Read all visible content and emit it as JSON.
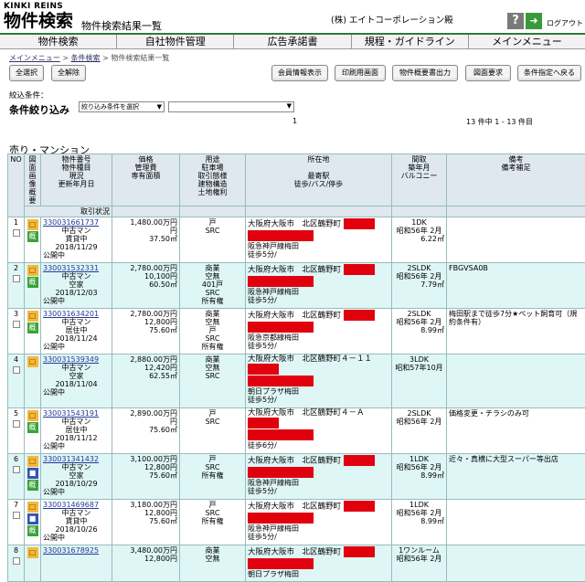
{
  "header": {
    "brand_en": "KINKI REINS",
    "title": "物件検索",
    "subtitle": "物件検索結果一覧",
    "company": "(株) エイトコーポレーション殿",
    "help_icon": "?",
    "logout": "ログアウト",
    "accent": "#2c7a3a"
  },
  "nav": [
    "物件検索",
    "自社物件管理",
    "広告承諾書",
    "規程・ガイドライン",
    "メインメニュー"
  ],
  "breadcrumb": {
    "items": [
      "メインメニュー",
      "条件検索",
      "物件検索結果一覧"
    ],
    "sep": ">"
  },
  "buttons": {
    "select_all": "全選択",
    "clear_all": "全解除",
    "member_info": "会員情報表示",
    "print": "印刷用画面",
    "summary": "物件概要書出力",
    "map": "図面要求",
    "back": "条件指定へ戻る"
  },
  "filter": {
    "label": "絞込条件：",
    "refine_label": "条件絞り込み",
    "select_value": "絞り込み条件を選択",
    "pager_page": "1",
    "count": "13 件中 1 - 13 件目"
  },
  "section_title": "売り・マンション",
  "columns": {
    "no": "NO",
    "media": [
      "図面",
      "画像",
      "概要"
    ],
    "id": [
      "物件番号",
      "物件種目",
      "現況",
      "更新年月日"
    ],
    "price": [
      "価格",
      "管理費",
      "専有面積"
    ],
    "use": [
      "用途",
      "駐車場",
      "取引態様",
      "建物構造",
      "土地権利"
    ],
    "addr": [
      "所在地",
      "",
      "最寄駅",
      "徒歩/バス/停歩"
    ],
    "layout": [
      "間取",
      "築年月",
      "バルコニー"
    ],
    "note": [
      "備考",
      "備考補足"
    ],
    "deal": "取引状況"
  },
  "rows": [
    {
      "no": "1",
      "id": "330031661737",
      "type": "中古マン",
      "status": "賃貸中",
      "date": "2018/11/29",
      "price": "1,480.00万円",
      "fee": "円",
      "area": "37.50㎡",
      "use": "",
      "parking": "",
      "mode": "戸",
      "struct": "SRC",
      "right": "",
      "addr": "大阪府大阪市　北区鶴野町",
      "station": "阪急神戸線梅田",
      "walk": "徒歩5分/",
      "layout": "1DK",
      "built": "昭和56年 2月",
      "balcony": "6.22㎡",
      "note": "",
      "deal": "公開中",
      "icons": [
        "y",
        "g"
      ]
    },
    {
      "no": "2",
      "id": "330031532331",
      "type": "中古マン",
      "status": "空家",
      "date": "2018/12/03",
      "price": "2,780.00万円",
      "fee": "10,100円",
      "area": "60.50㎡",
      "use": "商業",
      "parking": "空無",
      "mode": "401戸",
      "struct": "SRC",
      "right": "所有権",
      "addr": "大阪府大阪市　北区鶴野町",
      "station": "阪急神戸線梅田",
      "walk": "徒歩5分/",
      "layout": "2SLDK",
      "built": "昭和56年 2月",
      "balcony": "7.79㎡",
      "note": "FBGVSA0B",
      "deal": "公開中",
      "icons": [
        "y",
        "g"
      ]
    },
    {
      "no": "3",
      "id": "330031634201",
      "type": "中古マン",
      "status": "居住中",
      "date": "2018/11/24",
      "price": "2,780.00万円",
      "fee": "12,800円",
      "area": "75.60㎡",
      "use": "商業",
      "parking": "空無",
      "mode": "戸",
      "struct": "SRC",
      "right": "所有権",
      "addr": "大阪府大阪市　北区鶴野町",
      "station": "阪急京都線梅田",
      "walk": "徒歩5分/",
      "layout": "2SLDK",
      "built": "昭和56年 2月",
      "balcony": "8.99㎡",
      "note": "梅田駅まで徒歩7分★ペット飼育可（規約条件有）",
      "deal": "公開中",
      "icons": [
        "y",
        "g"
      ]
    },
    {
      "no": "4",
      "id": "330031539349",
      "type": "中古マン",
      "status": "空家",
      "date": "2018/11/04",
      "price": "2,880.00万円",
      "fee": "12,420円",
      "area": "62.55㎡",
      "use": "商業",
      "parking": "空無",
      "mode": "",
      "struct": "SRC",
      "right": "",
      "addr": "大阪府大阪市　北区鶴野町４－１１",
      "addr2": "朝日プラザ梅田",
      "station": "",
      "walk": "徒歩5分/",
      "layout": "3LDK",
      "built": "昭和57年10月",
      "balcony": "",
      "note": "",
      "deal": "公開中",
      "icons": [
        "y"
      ]
    },
    {
      "no": "5",
      "id": "330031543191",
      "type": "中古マン",
      "status": "居住中",
      "date": "2018/11/12",
      "price": "2,890.00万円",
      "fee": "円",
      "area": "75.60㎡",
      "use": "",
      "parking": "",
      "mode": "戸",
      "struct": "SRC",
      "right": "",
      "addr": "大阪府大阪市　北区鶴野町４－Ａ",
      "station": "",
      "walk": "徒歩6分/",
      "layout": "2SLDK",
      "built": "昭和56年 2月",
      "balcony": "",
      "note": "価格変更・チラシのみ可",
      "deal": "公開中",
      "icons": [
        "y",
        "g"
      ]
    },
    {
      "no": "6",
      "id": "330031341432",
      "type": "中古マン",
      "status": "空家",
      "date": "2018/10/29",
      "price": "3,100.00万円",
      "fee": "12,800円",
      "area": "75.60㎡",
      "use": "",
      "parking": "",
      "mode": "戸",
      "struct": "SRC",
      "right": "所有権",
      "addr": "大阪府大阪市　北区鶴野町",
      "station": "阪急神戸線梅田",
      "walk": "徒歩5分/",
      "layout": "1LDK",
      "built": "昭和56年 2月",
      "balcony": "8.99㎡",
      "note": "近々・真横に大型スーパー等出店",
      "deal": "公開中",
      "icons": [
        "y",
        "b",
        "g"
      ]
    },
    {
      "no": "7",
      "id": "330031469687",
      "type": "中古マン",
      "status": "賃貸中",
      "date": "2018/10/26",
      "price": "3,180.00万円",
      "fee": "12,800円",
      "area": "75.60㎡",
      "use": "",
      "parking": "",
      "mode": "戸",
      "struct": "SRC",
      "right": "所有権",
      "addr": "大阪府大阪市　北区鶴野町",
      "station": "阪急神戸線梅田",
      "walk": "徒歩5分/",
      "layout": "1LDK",
      "built": "昭和56年 2月",
      "balcony": "8.99㎡",
      "note": "",
      "deal": "公開中",
      "icons": [
        "y",
        "b",
        "g"
      ]
    },
    {
      "no": "8",
      "id": "330031678925",
      "type": "",
      "status": "",
      "date": "",
      "price": "3,480.00万円",
      "fee": "12,800円",
      "area": "",
      "use": "商業",
      "parking": "空無",
      "mode": "",
      "struct": "",
      "right": "",
      "addr": "大阪府大阪市　北区鶴野町",
      "addr2": "朝日プラザ梅田",
      "station": "",
      "walk": "",
      "layout": "1ワンルーム",
      "built": "昭和56年 2月",
      "balcony": "",
      "note": "",
      "deal": "",
      "icons": [
        "y"
      ]
    }
  ]
}
